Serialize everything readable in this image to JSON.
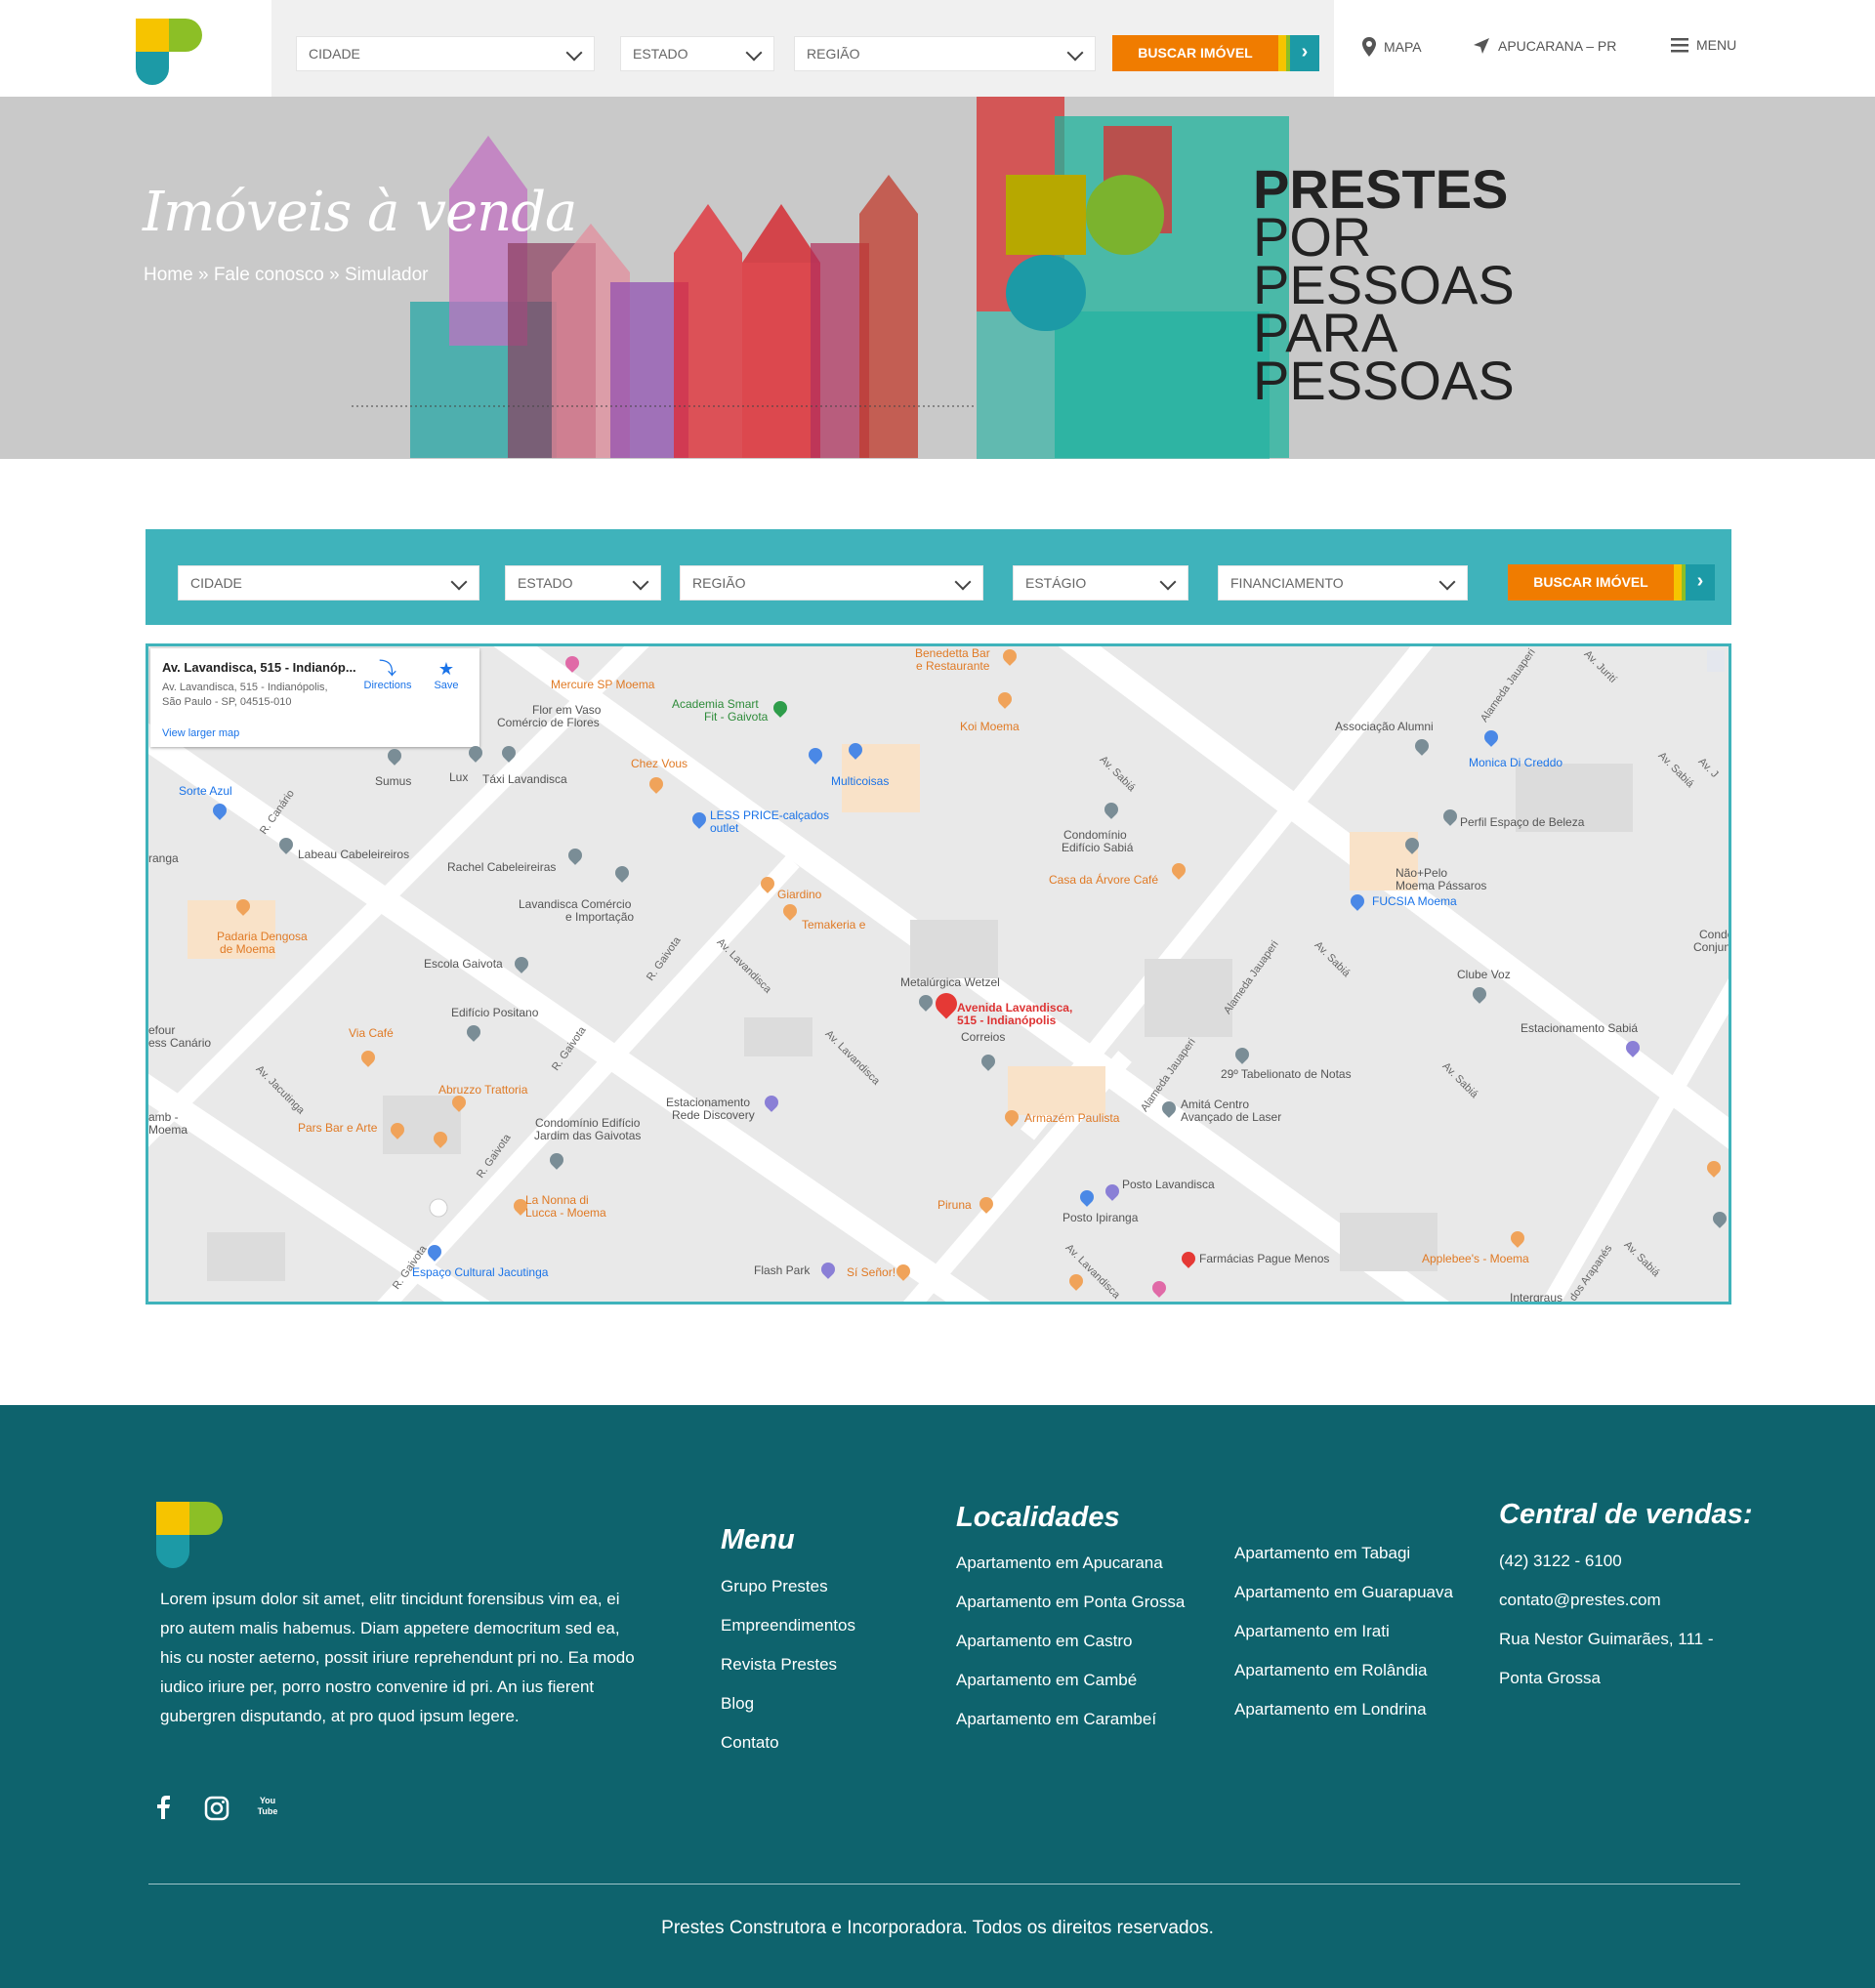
{
  "header": {
    "search": {
      "cidade": "CIDADE",
      "estado": "ESTADO",
      "regiao": "REGIÃO",
      "buscar": "BUSCAR IMÓVEL"
    },
    "nav": {
      "mapa": "MAPA",
      "location": "APUCARANA – PR",
      "menu": "MENU"
    }
  },
  "hero": {
    "title": "Imóveis à venda",
    "breadcrumb": {
      "home": "Home",
      "sep1": " » ",
      "contact": "Fale conosco",
      "sep2": " » ",
      "current": "Simulador"
    },
    "brand_lines": [
      "PRESTES",
      "POR",
      "PESSOAS",
      "PARA",
      "PESSOAS"
    ]
  },
  "filters": {
    "cidade": "CIDADE",
    "estado": "ESTADO",
    "regiao": "REGIÃO",
    "estagio": "ESTÁGIO",
    "financiamento": "FINANCIAMENTO",
    "buscar": "BUSCAR IMÓVEL"
  },
  "map": {
    "card": {
      "title": "Av. Lavandisca, 515 - Indianóp...",
      "line1": "Av. Lavandisca, 515 - Indianópolis,",
      "line2": "São Paulo - SP, 04515-010",
      "directions": "Directions",
      "save": "Save",
      "larger": "View larger map"
    },
    "marker_label_1": "Avenida Lavandisca,",
    "marker_label_2": "515 - Indianópolis",
    "places": [
      "Mercure SP Moema",
      "Flor em Vaso",
      "Comércio de Flores",
      "Academia Smart",
      "Fit - Gaivota",
      "Benedetta Bar",
      "e Restaurante",
      "Koi Moema",
      "Associação Alumni",
      "Monica Di Creddo",
      "Sumus",
      "Lux",
      "Táxi Lavandisca",
      "Chez Vous",
      "Multicoisas",
      "Sorte Azul",
      "LESS PRICE-calçados",
      "outlet",
      "Condomínio",
      "Edifício Sabiá",
      "Perfil Espaço de Beleza",
      "Labeau Cabeleireiros",
      "Rachel Cabeleireiras",
      "Casa da Árvore Café",
      "Não+Pelo",
      "Moema Pássaros",
      "FUCSIA Moema",
      "Giardino",
      "Lavandisca Comércio",
      "e Importação",
      "Padaria Dengosa",
      "de Moema",
      "Temakeria e",
      "Escola Gaivota",
      "Metalúrgica Wetzel",
      "Clube Voz",
      "Conjunto Son",
      "Edifício Positano",
      "Correios",
      "Estacionamento Sabiá",
      "Via Café",
      "29º Tabelionato de Notas",
      "Abruzzo Trattoria",
      "Estacionamento",
      "Rede Discovery",
      "Armazém Paulista",
      "Amitá Centro",
      "Avançado de Laser",
      "Pars Bar e Arte",
      "Condomínio Edifício",
      "Jardim das Gaivotas",
      "Posto Lavandisca",
      "La Nonna di",
      "Lucca - Moema",
      "Piruna",
      "Posto Ipiranga",
      "Farmácias Pague Menos",
      "Applebee's - Moema",
      "Espaço Cultural Jacutinga",
      "Flash Park",
      "Sí Señor!",
      "Intergraus",
      "Condo",
      "ranga",
      "efour",
      "ess Canário",
      "amb -",
      "Moema"
    ],
    "streets": [
      "R. Canário",
      "R. Gaivota",
      "R. Gaivota",
      "R. Gaivota",
      "R. Gaivota",
      "Av. Lavandisca",
      "Av. Lavandisca",
      "Av. Lavandisca",
      "Av. Sabiá",
      "Av. Sabiá",
      "Av. Sabiá",
      "Av. Sabiá",
      "Av. Sabiá",
      "Alameda Jauaperi",
      "Alameda Jauaperi",
      "Alameda Jauaperi",
      "Av. Jacutinga",
      "Av. Jurití",
      "dos Arapanés",
      "Av. J"
    ]
  },
  "footer": {
    "about": "Lorem ipsum dolor sit amet, elitr tincidunt forensibus vim ea, ei pro autem malis habemus. Diam appetere democritum sed ea, his cu noster aeterno, possit iriure reprehendunt pri no. Ea modo iudico iriure per, porro nostro convenire id pri. An ius fierent gubergren disputando, at pro quod ipsum legere.",
    "menu_title": "Menu",
    "menu_items": [
      "Grupo Prestes",
      "Empreendimentos",
      "Revista Prestes",
      "Blog",
      "Contato"
    ],
    "loc_title": "Localidades",
    "loc_col1": [
      "Apartamento em Apucarana",
      "Apartamento em Ponta Grossa",
      "Apartamento em Castro",
      "Apartamento em Cambé",
      "Apartamento em Carambeí"
    ],
    "loc_col2": [
      "Apartamento em Tabagi",
      "Apartamento em Guarapuava",
      "Apartamento em Irati",
      "Apartamento em Rolândia",
      "Apartamento em Londrina"
    ],
    "sales_title": "Central de vendas:",
    "phone": "(42)  3122 - 6100",
    "email": "contato@prestes.com",
    "address1": "Rua Nestor Guimarães, 111 -",
    "address2": "Ponta Grossa",
    "social": [
      "facebook-icon",
      "instagram-icon",
      "youtube-icon"
    ],
    "youtube_text": "You Tube",
    "copyright": "Prestes Construtora e Incorporadora. Todos os direitos reservados."
  },
  "colors": {
    "teal": "#3fb3bb",
    "dark_teal": "#0e636d",
    "orange": "#f07c00",
    "yellow": "#f6c400",
    "green": "#8cbf26",
    "logo_teal": "#1c9aa6"
  }
}
